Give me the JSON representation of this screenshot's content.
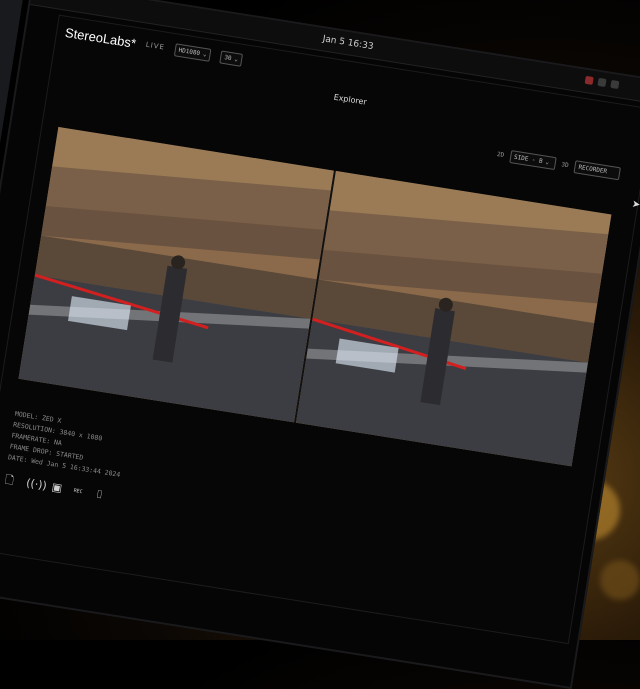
{
  "app": {
    "brand": "StereoLabs*",
    "live_label": "LIVE",
    "resolution_select": "HD1080",
    "fps_select": "30",
    "window_title": "Explorer",
    "clock": "Jan 5 16:33"
  },
  "toolbar": {
    "view_label": "2D",
    "view_select": "SIDE - B",
    "depth_label": "3D",
    "record_button": "RECORDER"
  },
  "info": {
    "model": "MODEL: ZED X",
    "resolution": "RESOLUTION: 3840 x 1080",
    "framerate": "FRAMERATE: NA",
    "frame_drop": "FRAME DROP: STARTED",
    "date": "DATE: Wed Jan 5 16:33:44 2024"
  },
  "controls": {
    "record_label": "REC"
  },
  "colors": {
    "background": "#000000",
    "accent_red": "#d21f1f",
    "panel": "#060607"
  }
}
